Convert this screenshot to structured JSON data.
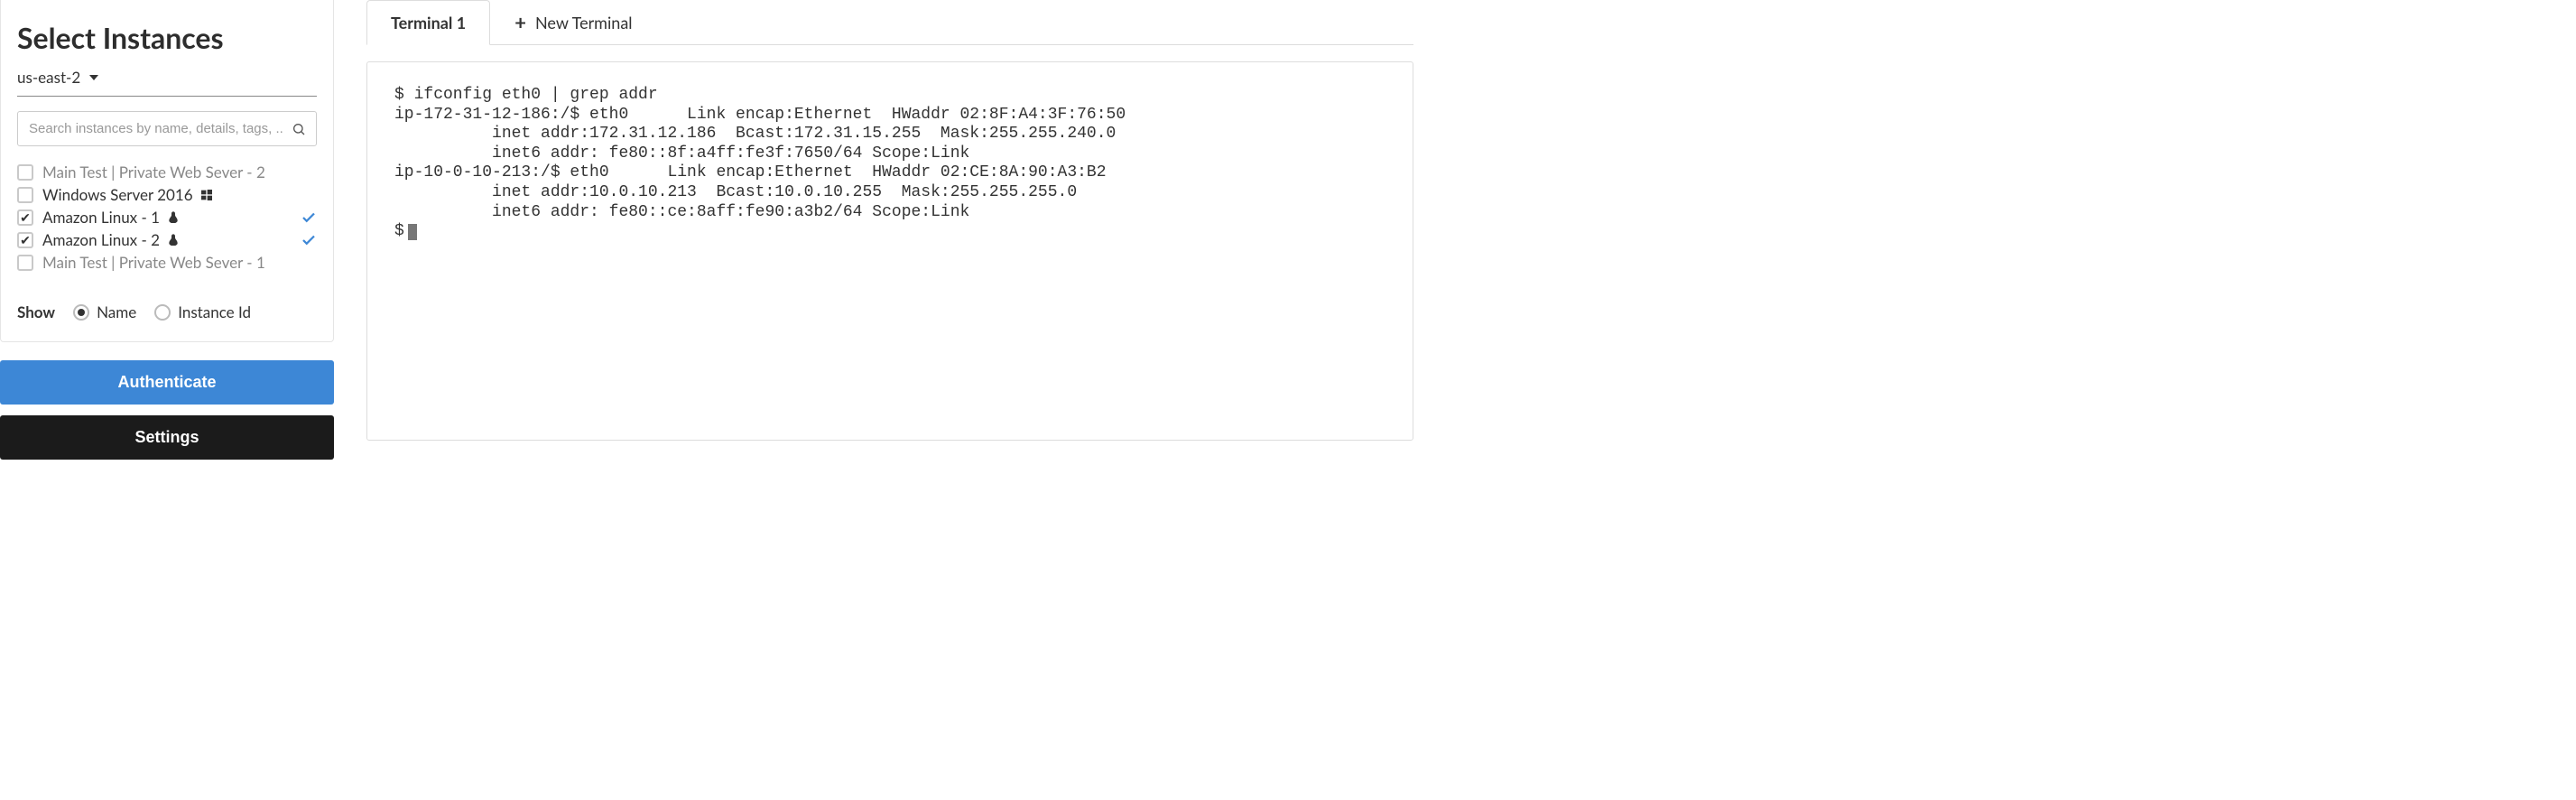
{
  "sidebar": {
    "title": "Select Instances",
    "region": "us-east-2",
    "search_placeholder": "Search instances by name, details, tags, ...",
    "instances": [
      {
        "label": "Main Test | Private Web Sever - 2",
        "checked": false,
        "connected": false,
        "os": "none"
      },
      {
        "label": "Windows Server 2016",
        "checked": false,
        "connected": false,
        "os": "windows"
      },
      {
        "label": "Amazon Linux - 1",
        "checked": true,
        "connected": true,
        "os": "linux"
      },
      {
        "label": "Amazon Linux - 2",
        "checked": true,
        "connected": true,
        "os": "linux"
      },
      {
        "label": "Main Test | Private Web Sever - 1",
        "checked": false,
        "connected": false,
        "os": "none"
      }
    ],
    "show_label": "Show",
    "show_options": {
      "name": "Name",
      "instance_id": "Instance Id"
    },
    "show_selected": "name",
    "authenticate_label": "Authenticate",
    "settings_label": "Settings"
  },
  "tabs": {
    "active": "Terminal 1",
    "new_label": "New Terminal"
  },
  "terminal": {
    "lines": "$ ifconfig eth0 | grep addr\nip-172-31-12-186:/$ eth0      Link encap:Ethernet  HWaddr 02:8F:A4:3F:76:50\n          inet addr:172.31.12.186  Bcast:172.31.15.255  Mask:255.255.240.0\n          inet6 addr: fe80::8f:a4ff:fe3f:7650/64 Scope:Link\nip-10-0-10-213:/$ eth0      Link encap:Ethernet  HWaddr 02:CE:8A:90:A3:B2\n          inet addr:10.0.10.213  Bcast:10.0.10.255  Mask:255.255.255.0\n          inet6 addr: fe80::ce:8aff:fe90:a3b2/64 Scope:Link",
    "prompt": "$"
  }
}
